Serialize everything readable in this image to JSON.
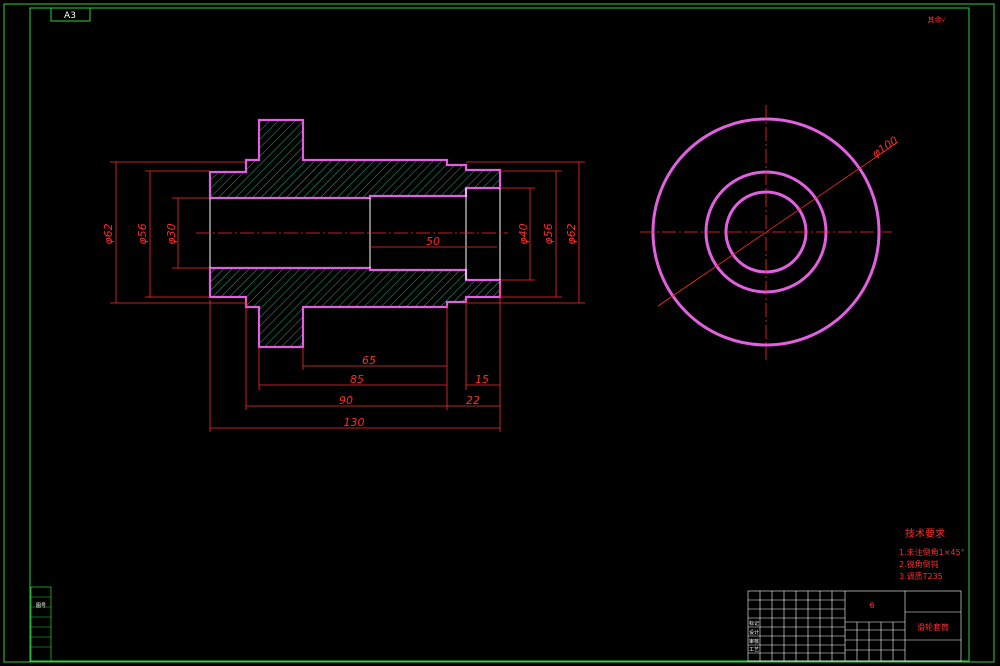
{
  "corner_tag": "A3",
  "top_right_note": "其余√",
  "colors": {
    "frame": "#2bd13a",
    "dimension": "#ff2a2a",
    "outline": "#e060e0",
    "hatch": "#2ad4a0",
    "center": "#ff2a2a"
  },
  "dimensions": {
    "left_dia_62": "φ62",
    "left_dia_56": "φ56",
    "left_dia_30": "φ30",
    "bore_len_50": "50",
    "right_dia_40": "φ40",
    "right_dia_56": "φ56",
    "right_dia_62": "φ62",
    "len_65": "65",
    "len_85": "85",
    "len_15": "15",
    "len_90": "90",
    "len_22": "22",
    "len_130": "130",
    "circle_dia_100": "φ100"
  },
  "tech_requirements": {
    "title": "技术要求",
    "items": [
      "1.未注倒角1×45°",
      "2.锐角倒钝",
      "3.调质T235"
    ]
  },
  "title_block": {
    "part_code": "6",
    "part_name": "滑轮套筒",
    "row_labels": [
      "标记",
      "设计",
      "审核",
      "工艺"
    ]
  },
  "side_strip_label": "图号"
}
